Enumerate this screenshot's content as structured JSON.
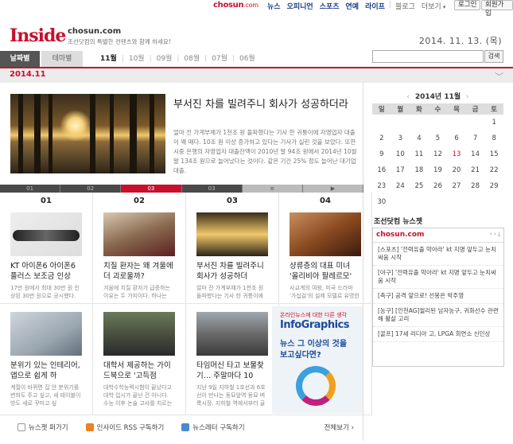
{
  "topbar": {
    "logo": "chosun",
    "logo_suffix": ".com",
    "nav": [
      "뉴스",
      "오피니언",
      "스포츠",
      "연예",
      "라이프"
    ],
    "plain_nav": [
      "블로그",
      "더보기"
    ],
    "login": "로그인",
    "signup": "회원가입"
  },
  "header": {
    "title": "Inside",
    "sub_logo": "chosun.com",
    "tagline": "조선닷컴의 특별한 컨텐츠와 함께 하세요!",
    "date": "2014. 11. 13. (목)"
  },
  "tabs": {
    "by_date": "날짜별",
    "by_theme": "테마별",
    "months": [
      "11월",
      "10월",
      "09월",
      "08월",
      "07월",
      "06월"
    ],
    "search_button": "검색"
  },
  "monthbar": {
    "label": "2014.11"
  },
  "hero": {
    "title": "부서진 차를 빌려주니 회사가 성공하더라",
    "desc": "얼마 전 가계부채가 1천조 원 돌파했다는 기사 한 귀퉁이에 자영업자 대출이 꽤 매다. 10조 원 이상 증가하고 있다는 기사가 실린 것을 보았다. 또한 시중 은행의 자영업자 대출잔액이 2010년 말 94조 원에서 2014년 10월 말 134조 원으로 늘어났다는 것이다. 같은 기간 25% 정도 늘어난 대기업 대출."
  },
  "numbar": [
    "01",
    "02",
    "03",
    "03",
    "≡",
    "▶"
  ],
  "articles": [
    {
      "rank": "01",
      "title": "KT 아이폰6 아이폰6 플러스 보조금 인상",
      "desc": "17만 원에서 최대 30만 원 인상된 30만 원으로 공시했다.",
      "thumb": "t1"
    },
    {
      "rank": "02",
      "title": "치질 환자는 왜 겨울에 더 괴로울까?",
      "desc": "겨울에 치질 환자가 급증하는 이유는 두 가지이다. 하나는",
      "thumb": "t2"
    },
    {
      "rank": "03",
      "title": "부서진 차를 빌려주니 회사가 성공하더",
      "desc": "얼마 전 가계부채가 1천조 원 돌파했다는 기사 한 귀퉁이에",
      "thumb": "t3"
    },
    {
      "rank": "04",
      "title": "샹류층의 대표 미녀 '올리비아 팔레르모'",
      "desc": "사교계의 여왕, 미국 드라마 '가십걸'의 실제 모델로 유명한",
      "thumb": "t4"
    },
    {
      "rank": "",
      "title": "분위기 있는 인테리어, 앱으로 쉽게 하",
      "desc": "계절이 바뀌면 집 안 분위기를 변화도 주고 싶고, 새 테이블이 방도 새로 꾸미고 싶",
      "thumb": "t5"
    },
    {
      "rank": "",
      "title": "대학서 제공하는 가이드북으로 '고득점",
      "desc": "대학수학능력시험이 끝났다고 대학 입시가 끝난 건 아니다. 수능 이후 논술 고사를 치르는",
      "thumb": "t6"
    },
    {
      "rank": "",
      "title": "타임머신 타고 보물찾기… 주말마다 10",
      "desc": "지난 9일 지하철 1호선과 6호선이 만나는 동묘앞역 동묘 벼룩시장. 지하철 역에서부터 골",
      "thumb": "t7"
    }
  ],
  "infographic": {
    "small": "온라인뉴스에 대한 다른 생각",
    "title": "InfoGraphics",
    "line1": "뉴스 그 이상의 것을",
    "line2": "보고싶다면?"
  },
  "footer": {
    "items": [
      "뉴스젯 퍼가기",
      "인사이드 RSS 구독하기",
      "뉴스레터 구독하기"
    ],
    "all": "전체보기 ›"
  },
  "calendar": {
    "head": "2014년 11월",
    "days": [
      "일",
      "월",
      "화",
      "수",
      "목",
      "금",
      "토"
    ],
    "rows": [
      [
        "",
        "",
        "",
        "",
        "",
        "",
        "1"
      ],
      [
        "2",
        "3",
        "4",
        "5",
        "6",
        "7",
        "8"
      ],
      [
        "9",
        "10",
        "11",
        "12",
        "13",
        "14",
        "15"
      ],
      [
        "16",
        "17",
        "18",
        "19",
        "20",
        "21",
        "22"
      ],
      [
        "23",
        "24",
        "25",
        "26",
        "27",
        "28",
        "29"
      ],
      [
        "30",
        "",
        "",
        "",
        "",
        "",
        ""
      ]
    ],
    "today": "13"
  },
  "news": {
    "title": "조선닷컴 뉴스젯",
    "box_logo": "chosun.com",
    "items": [
      "[스포츠] '전력유출 막아라' kt 지명 앞두고 눈치싸움 시작",
      "[야구] '전력유출 막아라' kt 지명 앞두고 눈치싸움 시작",
      "[축구] 공격 앞으로! 선봉은 박주영",
      "[농구] [인천AG]윌리된 남자농구, 귀화선수 관련해 활살 고리",
      "[골프] 17세 리디아 고, LPGA 회연소 신인상"
    ]
  }
}
